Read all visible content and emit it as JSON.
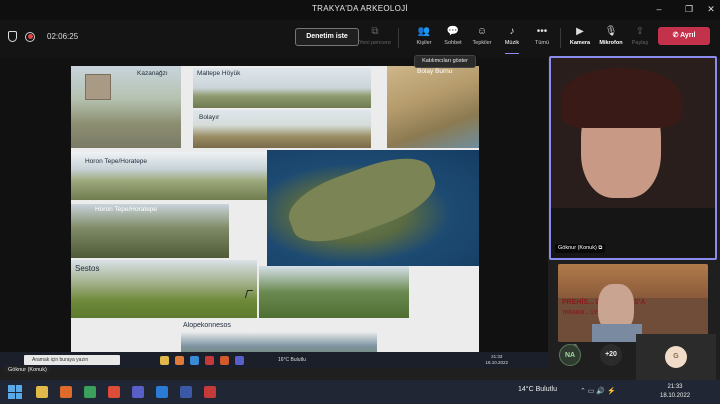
{
  "window": {
    "title": "TRAKYA'DA ARKEOLOJİ"
  },
  "meeting": {
    "timer": "02:06:25",
    "review_button": "Denetim iste",
    "toolbar": [
      {
        "label": "Yeni pencere",
        "icon": "new-window-icon",
        "state": "disabled"
      },
      {
        "label": "Kişiler",
        "icon": "people-icon",
        "state": "normal"
      },
      {
        "label": "Sohbet",
        "icon": "chat-icon",
        "state": "normal"
      },
      {
        "label": "Tepkiler",
        "icon": "reactions-icon",
        "state": "normal"
      },
      {
        "label": "Müzik",
        "icon": "music-icon",
        "state": "active"
      },
      {
        "label": "Tümü",
        "icon": "more-icon",
        "state": "normal"
      },
      {
        "label": "Kamera",
        "icon": "camera-icon",
        "state": "bold"
      },
      {
        "label": "Mikrofon",
        "icon": "microphone-icon",
        "state": "bold"
      },
      {
        "label": "Paylaş",
        "icon": "share-icon",
        "state": "disabled"
      }
    ],
    "leave_button": "Ayrıl",
    "tooltip": "Katılımcıları göster"
  },
  "slide": {
    "captions": {
      "kazanagzi": "Kazanağzı",
      "maltepe": "Maltepe Höyük",
      "bolayir": "Bolayır",
      "top_right": "Bolay Burnu",
      "horon1": "Horon Tepe/Horatepe",
      "horon2": "Horon Tepe/Horatepe",
      "sestos": "Sestos",
      "alopekonnesos": "Alopekonnesos"
    }
  },
  "shared_taskbar": {
    "search_placeholder": "Aramak için buraya yazın",
    "weather": "16°C Bulutlu",
    "time": "21:33",
    "date": "18.10.2022",
    "presenter_label": "Göknur (Konuk)"
  },
  "participants": {
    "main_video_name": "Göknur (Konuk)",
    "shared_banner_line1": "PREHİS... DEN BİZANS'A",
    "shared_banner_line2": "THRAKIA ... LYSIMAKHEIA",
    "avatar_na": "NA",
    "overflow_count": "+20",
    "avatar_g": "G"
  },
  "taskbar": {
    "weather": "14°C  Bulutlu",
    "time": "21:33",
    "date": "18.10.2022"
  },
  "colors": {
    "accent": "#8b8cf0",
    "leave": "#c4314b",
    "background": "#1f1f1f"
  }
}
